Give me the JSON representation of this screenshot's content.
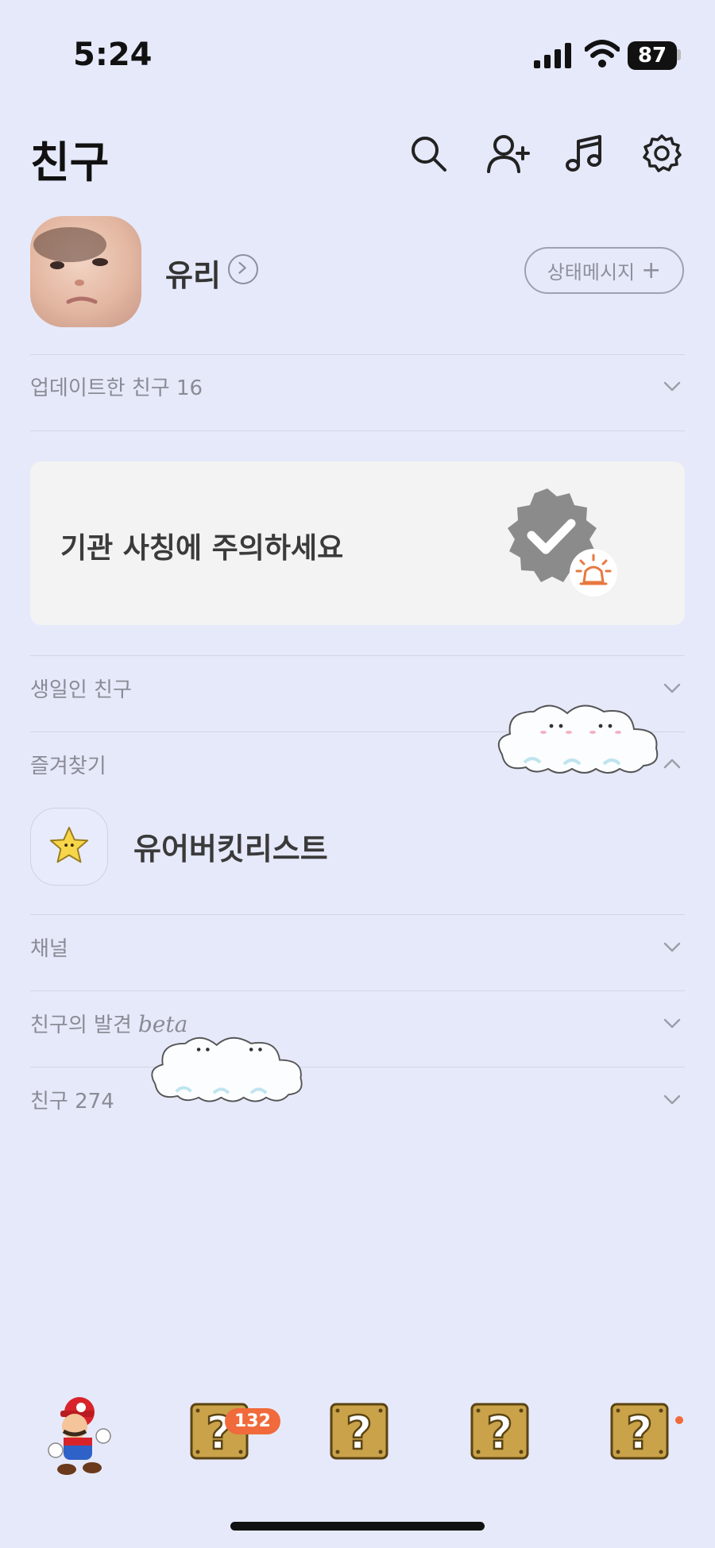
{
  "status_bar": {
    "time": "5:24",
    "battery": "87"
  },
  "header": {
    "title": "친구",
    "icons": [
      "search-icon",
      "add-friend-icon",
      "music-icon",
      "settings-icon"
    ]
  },
  "profile": {
    "name": "유리",
    "status_button": "상태메시지",
    "status_plus": "+"
  },
  "sections": {
    "updated": "업데이트한 친구 16",
    "birthday": "생일인 친구",
    "favorites": "즐겨찾기",
    "channel": "채널",
    "discover": "친구의 발견",
    "discover_tag": "beta",
    "friends": "친구 274"
  },
  "banner": {
    "text": "기관 사칭에 주의하세요"
  },
  "favorites_list": [
    {
      "name": "유어버킷리스트",
      "icon": "star-icon"
    }
  ],
  "tab_bar": {
    "badge_count": "132"
  },
  "colors": {
    "background": "#e6e9fa",
    "accent": "#f06a3b",
    "banner": "#f3f3f3"
  }
}
